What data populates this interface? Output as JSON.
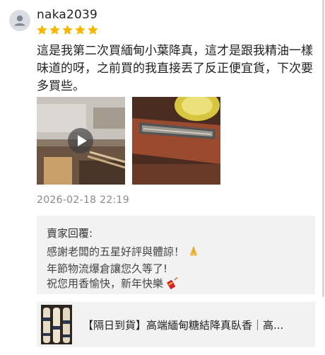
{
  "reviewer": {
    "username": "naka2039",
    "rating": 5,
    "avatar_icon": "user-icon"
  },
  "review": {
    "text": "這是我第二次買緬甸小葉降真，這才是跟我精油一樣味道的呀，之前買的我直接丟了反正便宜貨，下次要多買些。",
    "timestamp": "2026-02-18 22:19"
  },
  "media": [
    {
      "type": "video",
      "icon": "play-icon"
    },
    {
      "type": "image"
    }
  ],
  "seller_reply": {
    "title": "賣家回覆:",
    "lines": [
      "感謝老闆的五星好評與體諒！",
      "年節物流爆倉讓您久等了!",
      "祝您用香愉快，新年快樂"
    ],
    "emojis": [
      "folded-hands-icon",
      "firecracker-icon"
    ]
  },
  "product": {
    "title": "【隔日到貨】高端緬甸糖結降真臥香｜高..."
  },
  "colors": {
    "star": "#f6b800",
    "panel_bg": "#f2f2f2",
    "muted_text": "#8a8a8a"
  }
}
